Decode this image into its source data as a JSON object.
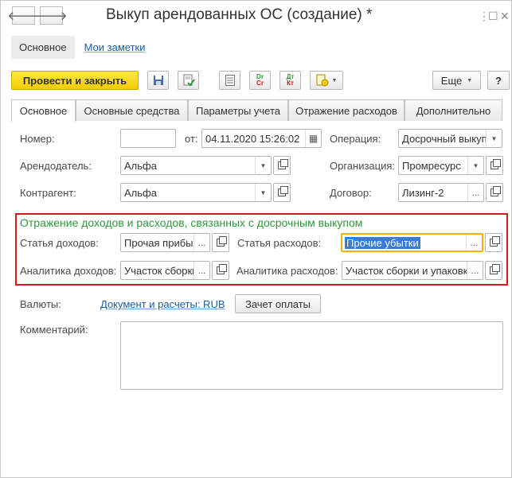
{
  "window": {
    "title": "Выкуп арендованных ОС (создание) *",
    "back_glyph": "🡐",
    "forward_glyph": "🡒",
    "menu_glyph": "⋮",
    "maximize_glyph": "☐",
    "close_glyph": "✕"
  },
  "topnav": {
    "main": "Основное",
    "notes": "Мои заметки"
  },
  "toolbar": {
    "post_close": "Провести и закрыть",
    "more": "Еще",
    "help": "?",
    "save_glyph": "💾",
    "dtkt_top": "Дт",
    "dtkt_bottom": "Кт",
    "drcr_top": "Dr",
    "drcr_bottom": "Cr"
  },
  "tabs": [
    "Основное",
    "Основные средства",
    "Параметры учета",
    "Отражение расходов",
    "Дополнительно"
  ],
  "form": {
    "number_label": "Номер:",
    "number_value": "",
    "from_label": "от:",
    "date_value": "04.11.2020 15:26:02",
    "operation_label": "Операция:",
    "operation_value": "Досрочный выкуп",
    "lessor_label": "Арендодатель:",
    "lessor_value": "Альфа",
    "org_label": "Организация:",
    "org_value": "Промресурс",
    "contractor_label": "Контрагент:",
    "contractor_value": "Альфа",
    "contract_label": "Договор:",
    "contract_value": "Лизинг-2"
  },
  "section": {
    "title": "Отражение доходов и расходов, связанных с досрочным выкупом",
    "income_item_label": "Статья доходов:",
    "income_item_value": "Прочая прибы...",
    "expense_item_label": "Статья расходов:",
    "expense_item_value": "Прочие убытки",
    "income_analytics_label": "Аналитика доходов:",
    "income_analytics_value": "Участок сборки",
    "expense_analytics_label": "Аналитика расходов:",
    "expense_analytics_value": "Участок сборки и упаковки"
  },
  "bottom": {
    "currency_label": "Валюты:",
    "currency_link": "Документ и расчеты: RUB",
    "offset_button": "Зачет оплаты",
    "comment_label": "Комментарий:",
    "comment_value": ""
  },
  "icons": {
    "dropdown": "▼",
    "dots": "...",
    "calendar": "▦"
  },
  "colors": {
    "primary_button": "#f5cc00",
    "highlight_border": "#d7191c",
    "section_title": "#2e9a3b",
    "focus_border": "#f0b400",
    "selection": "#3a7bd5"
  }
}
